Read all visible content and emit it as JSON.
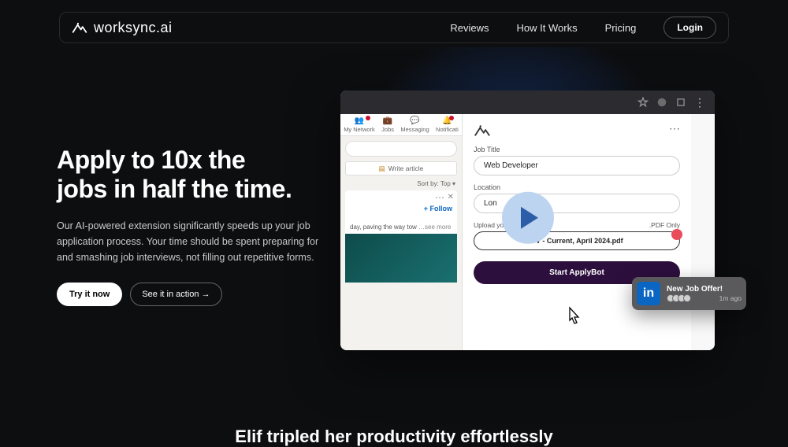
{
  "brand": {
    "name": "worksync.ai"
  },
  "nav": {
    "links": [
      "Reviews",
      "How It Works",
      "Pricing"
    ],
    "login": "Login"
  },
  "hero": {
    "title_l1": "Apply to 10x the",
    "title_l2": "jobs in half the time.",
    "subtitle": "Our AI-powered extension significantly speeds up your job application process. Your time should be spent preparing for and smashing job interviews, not filling out repetitive forms.",
    "cta_primary": "Try it now",
    "cta_secondary": "See it in action →"
  },
  "screenshot": {
    "linkedin": {
      "tabs": [
        "My Network",
        "Jobs",
        "Messaging",
        "Notificati"
      ],
      "write": "Write article",
      "sort": "Sort by: Top ▾",
      "follow": "+ Follow",
      "post_text": "day, paving the way tow",
      "more": "…see more"
    },
    "panel": {
      "job_title_label": "Job Title",
      "job_title_value": "Web Developer",
      "location_label": "Location",
      "location_value": "Lon",
      "upload_label": "Upload yo",
      "upload_hint": ".PDF Only",
      "cv_name": "CV - Current, April 2024.pdf",
      "start_btn": "Start ApplyBot"
    }
  },
  "toast": {
    "title": "New Job Offer!",
    "time": "1m ago"
  },
  "bottom_headline": "Elif tripled her productivity effortlessly"
}
